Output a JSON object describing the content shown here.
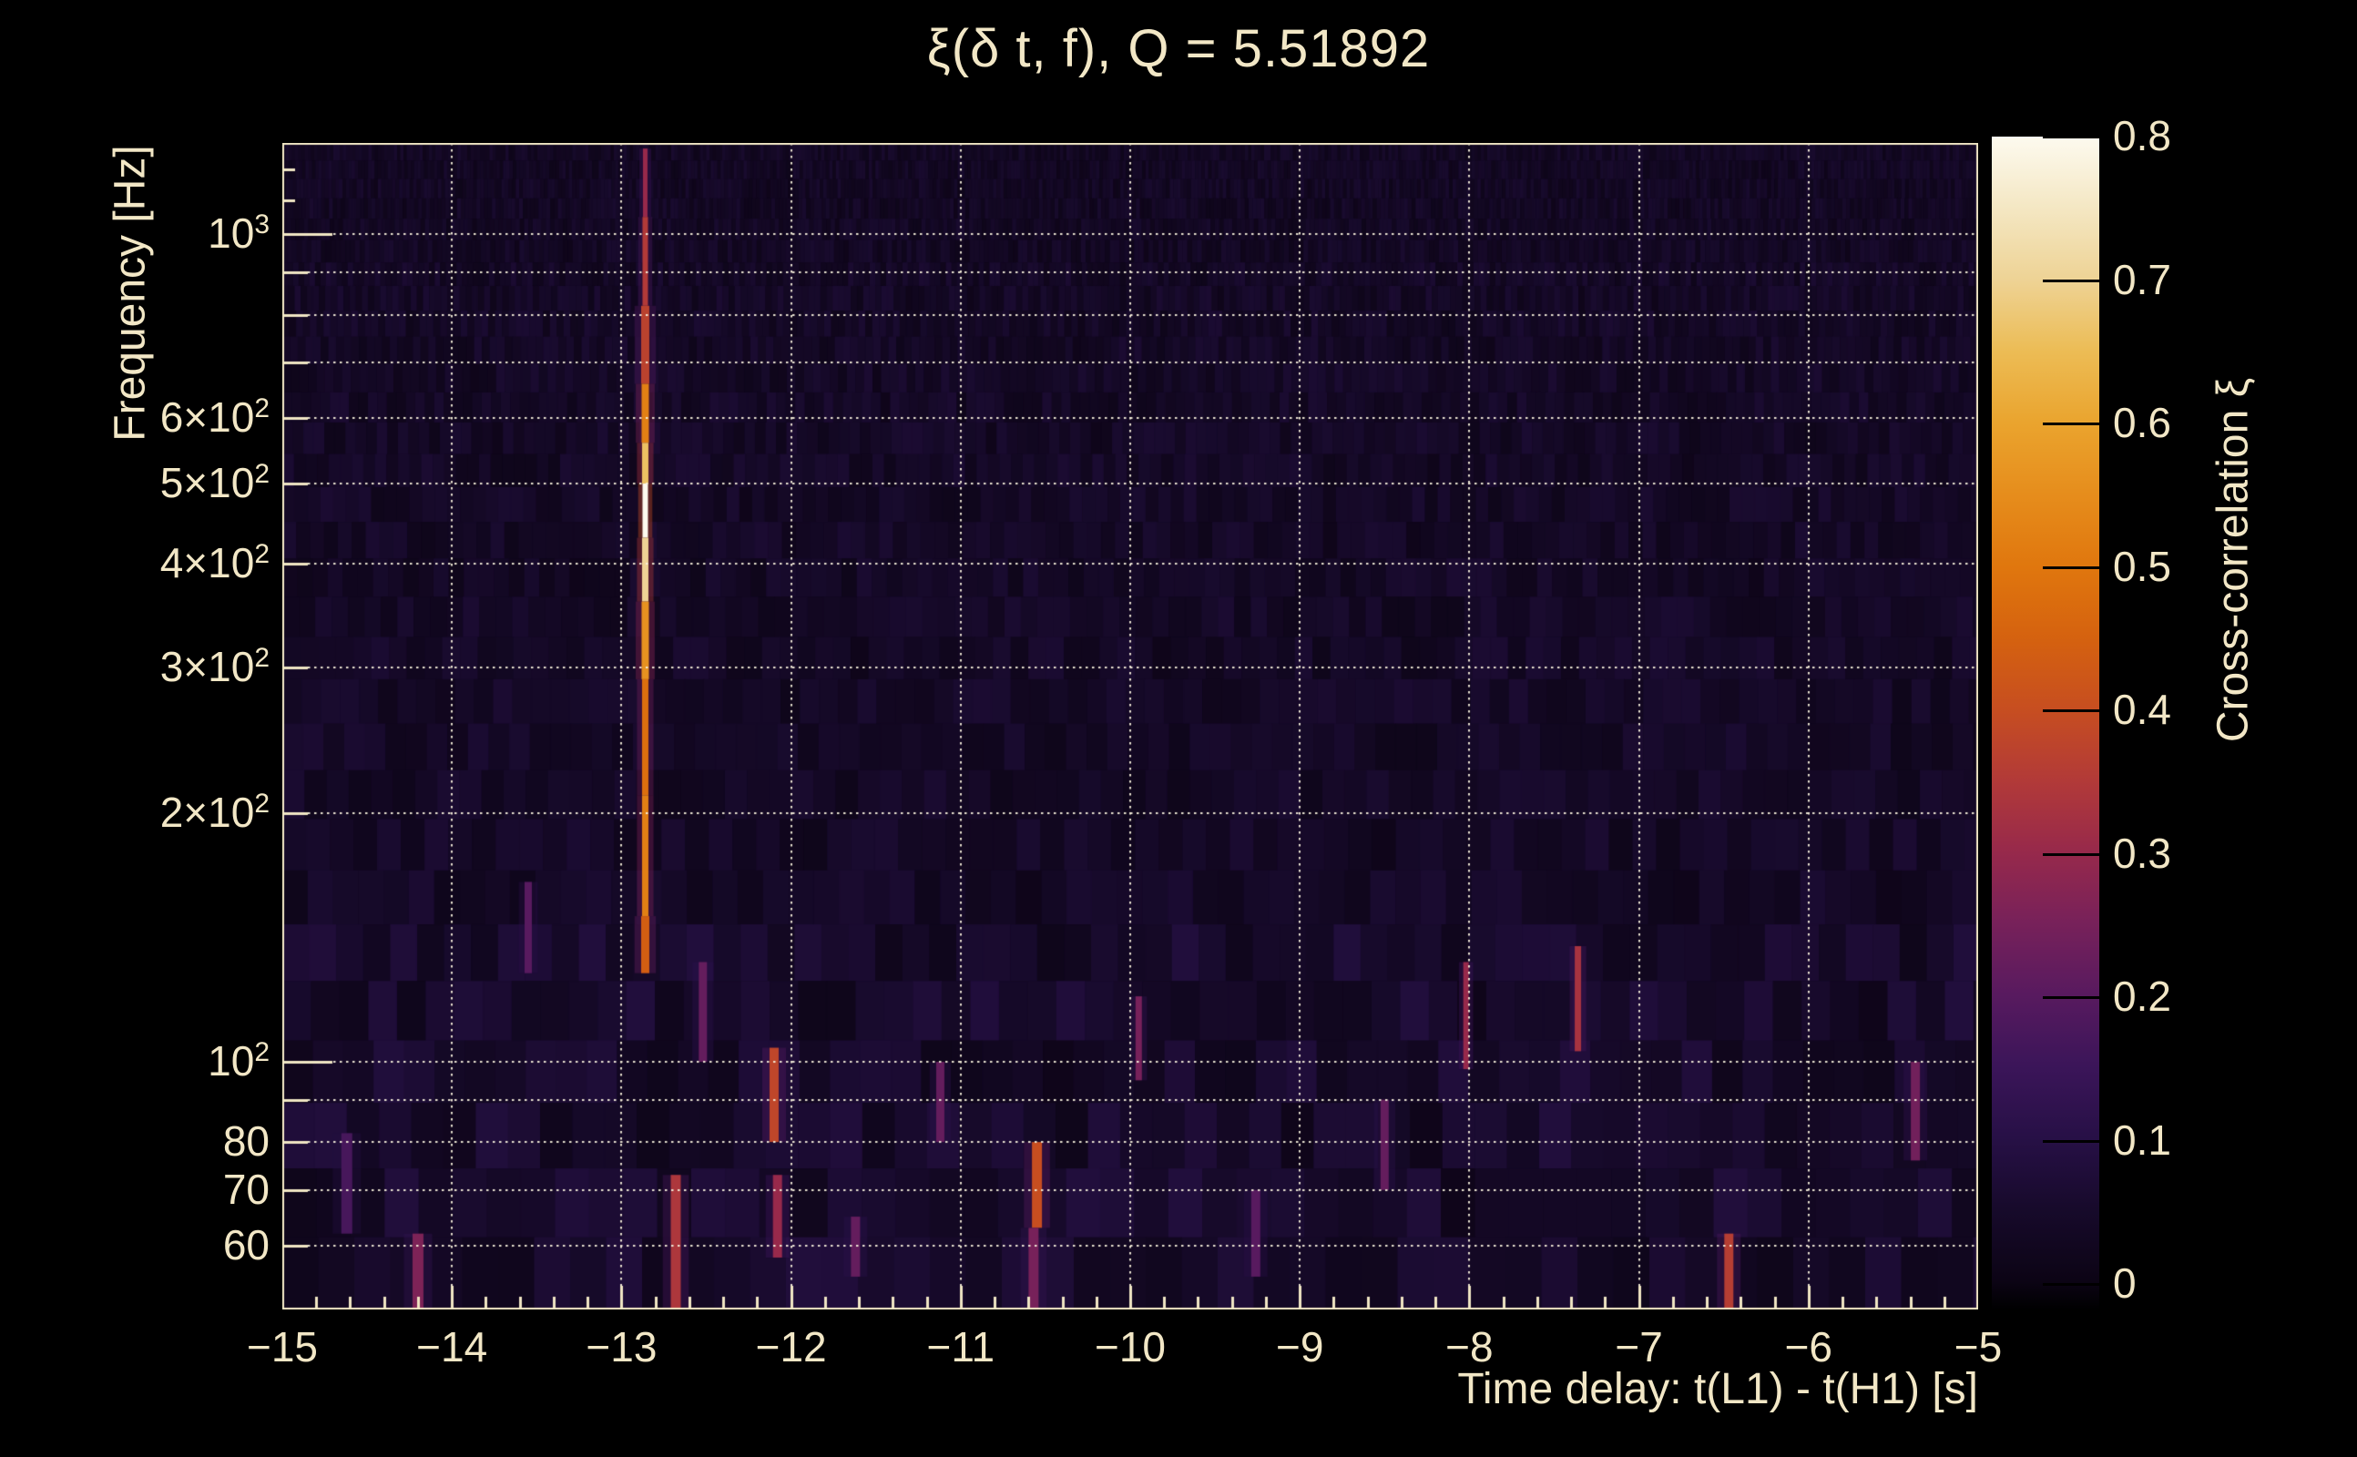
{
  "title": "ξ(δ t, f), Q = 5.51892",
  "axes": {
    "x": {
      "title": "Time delay: t(L1) - t(H1) [s]",
      "min": -15,
      "max": -5,
      "minor_step": 0.2,
      "tick_values": [
        -15,
        -14,
        -13,
        -12,
        -11,
        -10,
        -9,
        -8,
        -7,
        -6,
        -5
      ],
      "tick_labels": [
        "−15",
        "−14",
        "−13",
        "−12",
        "−11",
        "−10",
        "−9",
        "−8",
        "−7",
        "−6",
        "−5"
      ]
    },
    "y": {
      "title": "Frequency [Hz]",
      "scale": "log",
      "min": 50.2,
      "max": 1290,
      "tick_labels": [
        {
          "f": 1000,
          "base": "10",
          "sup": "3"
        },
        {
          "f": 600,
          "base": "6×10",
          "sup": "2"
        },
        {
          "f": 500,
          "base": "5×10",
          "sup": "2"
        },
        {
          "f": 400,
          "base": "4×10",
          "sup": "2"
        },
        {
          "f": 300,
          "base": "3×10",
          "sup": "2"
        },
        {
          "f": 200,
          "base": "2×10",
          "sup": "2"
        },
        {
          "f": 100,
          "base": "10",
          "sup": "2"
        },
        {
          "f": 80,
          "base": "80"
        },
        {
          "f": 70,
          "base": "70"
        },
        {
          "f": 60,
          "base": "60"
        }
      ],
      "gridline_freqs": [
        60,
        70,
        80,
        90,
        100,
        200,
        300,
        400,
        500,
        600,
        700,
        800,
        900,
        1000
      ],
      "decade_freqs": [
        100,
        1000
      ],
      "upper_minor_freqs": [
        1100,
        1200
      ]
    },
    "colorbar": {
      "title": "Cross-correlation ξ",
      "min": -0.02,
      "max": 0.8,
      "tick_values": [
        0.8,
        0.7,
        0.6,
        0.5,
        0.4,
        0.3,
        0.2,
        0.1,
        0
      ],
      "tick_labels": [
        "0.8",
        "0.7",
        "0.6",
        "0.5",
        "0.4",
        "0.3",
        "0.2",
        "0.1",
        "0"
      ]
    }
  },
  "chart_data": {
    "type": "heatmap",
    "title": "ξ(δ t, f), Q = 5.51892",
    "q_value": 5.51892,
    "xlabel": "Time delay: t(L1) - t(H1) [s]",
    "ylabel": "Frequency [Hz]",
    "zlabel": "Cross-correlation ξ",
    "x_range": [
      -15,
      -5
    ],
    "y_range_hz": [
      50.2,
      1290
    ],
    "z_range": [
      -0.02,
      0.8
    ],
    "grid": true,
    "legend_position": "right-colorbar",
    "main_peak": {
      "time_delay_s": -12.86,
      "freq_range_hz": [
        128,
        1270
      ],
      "peak_xi": 0.8,
      "peak_freq_hz": 465,
      "segments": [
        {
          "f_lo": 1050,
          "f_hi": 1270,
          "xi": 0.3,
          "w": 5
        },
        {
          "f_lo": 820,
          "f_hi": 1050,
          "xi": 0.35,
          "w": 6
        },
        {
          "f_lo": 660,
          "f_hi": 820,
          "xi": 0.37,
          "w": 9
        },
        {
          "f_lo": 560,
          "f_hi": 660,
          "xi": 0.52,
          "w": 8
        },
        {
          "f_lo": 500,
          "f_hi": 560,
          "xi": 0.66,
          "w": 7
        },
        {
          "f_lo": 430,
          "f_hi": 500,
          "xi": 0.8,
          "w": 6
        },
        {
          "f_lo": 360,
          "f_hi": 430,
          "xi": 0.7,
          "w": 7
        },
        {
          "f_lo": 290,
          "f_hi": 360,
          "xi": 0.56,
          "w": 8
        },
        {
          "f_lo": 210,
          "f_hi": 290,
          "xi": 0.48,
          "w": 7
        },
        {
          "f_lo": 150,
          "f_hi": 210,
          "xi": 0.52,
          "w": 7
        },
        {
          "f_lo": 128,
          "f_hi": 150,
          "xi": 0.44,
          "w": 9
        }
      ]
    },
    "secondary_features": [
      {
        "t": -12.1,
        "f_lo": 80,
        "f_hi": 104,
        "xi": 0.38,
        "w": 10
      },
      {
        "t": -12.08,
        "f_lo": 58,
        "f_hi": 73,
        "xi": 0.3,
        "w": 10
      },
      {
        "t": -12.68,
        "f_lo": 50,
        "f_hi": 73,
        "xi": 0.34,
        "w": 11
      },
      {
        "t": -14.2,
        "f_lo": 50,
        "f_hi": 62,
        "xi": 0.26,
        "w": 12
      },
      {
        "t": -14.62,
        "f_lo": 62,
        "f_hi": 82,
        "xi": 0.17,
        "w": 12
      },
      {
        "t": -12.52,
        "f_lo": 100,
        "f_hi": 132,
        "xi": 0.22,
        "w": 9
      },
      {
        "t": -10.55,
        "f_lo": 63,
        "f_hi": 80,
        "xi": 0.4,
        "w": 11
      },
      {
        "t": -10.57,
        "f_lo": 50,
        "f_hi": 63,
        "xi": 0.25,
        "w": 11
      },
      {
        "t": -8.02,
        "f_lo": 98,
        "f_hi": 132,
        "xi": 0.3,
        "w": 6
      },
      {
        "t": -7.36,
        "f_lo": 103,
        "f_hi": 138,
        "xi": 0.33,
        "w": 7
      },
      {
        "t": -6.47,
        "f_lo": 50,
        "f_hi": 62,
        "xi": 0.36,
        "w": 10
      },
      {
        "t": -5.37,
        "f_lo": 76,
        "f_hi": 100,
        "xi": 0.24,
        "w": 10
      },
      {
        "t": -13.55,
        "f_lo": 128,
        "f_hi": 165,
        "xi": 0.2,
        "w": 8
      },
      {
        "t": -11.12,
        "f_lo": 80,
        "f_hi": 100,
        "xi": 0.22,
        "w": 9
      },
      {
        "t": -9.26,
        "f_lo": 55,
        "f_hi": 70,
        "xi": 0.2,
        "w": 10
      },
      {
        "t": -8.5,
        "f_lo": 70,
        "f_hi": 90,
        "xi": 0.22,
        "w": 9
      },
      {
        "t": -9.95,
        "f_lo": 95,
        "f_hi": 120,
        "xi": 0.25,
        "w": 7
      },
      {
        "t": -11.62,
        "f_lo": 55,
        "f_hi": 65,
        "xi": 0.22,
        "w": 10
      }
    ],
    "background_noise_xi_range": [
      0,
      0.2
    ],
    "colormap_stops": [
      {
        "v": -0.02,
        "c": "#000000"
      },
      {
        "v": 0.0,
        "c": "#0c0415"
      },
      {
        "v": 0.05,
        "c": "#170a2b"
      },
      {
        "v": 0.1,
        "c": "#271046"
      },
      {
        "v": 0.15,
        "c": "#3b1559"
      },
      {
        "v": 0.2,
        "c": "#581a5f"
      },
      {
        "v": 0.25,
        "c": "#77215a"
      },
      {
        "v": 0.3,
        "c": "#97294b"
      },
      {
        "v": 0.35,
        "c": "#b23a38"
      },
      {
        "v": 0.4,
        "c": "#c74e20"
      },
      {
        "v": 0.45,
        "c": "#d5620f"
      },
      {
        "v": 0.5,
        "c": "#e0770e"
      },
      {
        "v": 0.55,
        "c": "#e68d1c"
      },
      {
        "v": 0.6,
        "c": "#eaa42e"
      },
      {
        "v": 0.65,
        "c": "#ecbc55"
      },
      {
        "v": 0.7,
        "c": "#eed395"
      },
      {
        "v": 0.75,
        "c": "#f4e7c3"
      },
      {
        "v": 0.8,
        "c": "#fdfaef"
      }
    ]
  },
  "style": {
    "background": "#000000",
    "text_color": "#f2e7c6",
    "frame_color": "#f0e6c4",
    "gridline_color": "rgba(247,240,219,0.95)",
    "colorbar_tick_color": "#000000"
  }
}
